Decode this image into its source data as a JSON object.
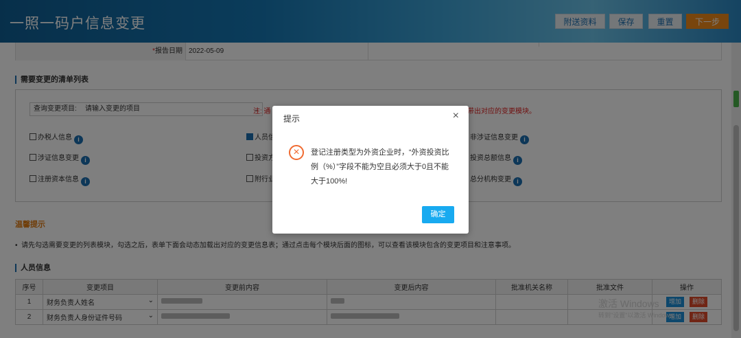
{
  "header": {
    "title": "一照一码户信息变更",
    "buttons": {
      "attach": "附送资料",
      "save": "保存",
      "reset": "重置",
      "next": "下一步"
    }
  },
  "form": {
    "report_date_label": "报告日期",
    "report_date_required": "*",
    "report_date_value": "2022-05-09"
  },
  "change_list": {
    "section_title": "需要变更的清单列表",
    "query_label": "查询变更项目:",
    "query_placeholder": "请输入变更的项目",
    "note_left": "注: 通",
    "note_right": "带出对应的变更模块。",
    "checkboxes": [
      {
        "label": "办税人信息",
        "checked": false
      },
      {
        "label": "人员信",
        "checked": true
      },
      {
        "label": "非涉证信息变更",
        "checked": false
      },
      {
        "label": "涉证信息变更",
        "checked": false
      },
      {
        "label": "投资方",
        "checked": false
      },
      {
        "label": "投资总额信息",
        "checked": false
      },
      {
        "label": "注册资本信息",
        "checked": false
      },
      {
        "label": "附行业",
        "checked": false
      },
      {
        "label": "总分机构变更",
        "checked": false
      }
    ]
  },
  "tips": {
    "title": "温馨提示",
    "text": "请先勾选需要变更的列表模块，勾选之后，表单下面会动态加载出对应的变更信息表；通过点击每个模块后面的图标，可以查看该模块包含的变更项目和注意事项。"
  },
  "personnel": {
    "section_title": "人员信息",
    "columns": [
      "序号",
      "变更项目",
      "变更前内容",
      "变更后内容",
      "批准机关名称",
      "批准文件",
      "操作"
    ],
    "rows": [
      {
        "index": "1",
        "item": "财务负责人姓名"
      },
      {
        "index": "2",
        "item": "财务负责人身份证件号码"
      }
    ],
    "add_label": "增加",
    "delete_label": "删除"
  },
  "watermark": {
    "line1": "激活 Windows",
    "line2": "转到\"设置\"以激活 Windows。"
  },
  "dialog": {
    "title": "提示",
    "close": "×",
    "message": "登记注册类型为外资企业时，“外资投资比例（%）”字段不能为空且必须大于0且不能大于100%!",
    "ok": "确定"
  }
}
